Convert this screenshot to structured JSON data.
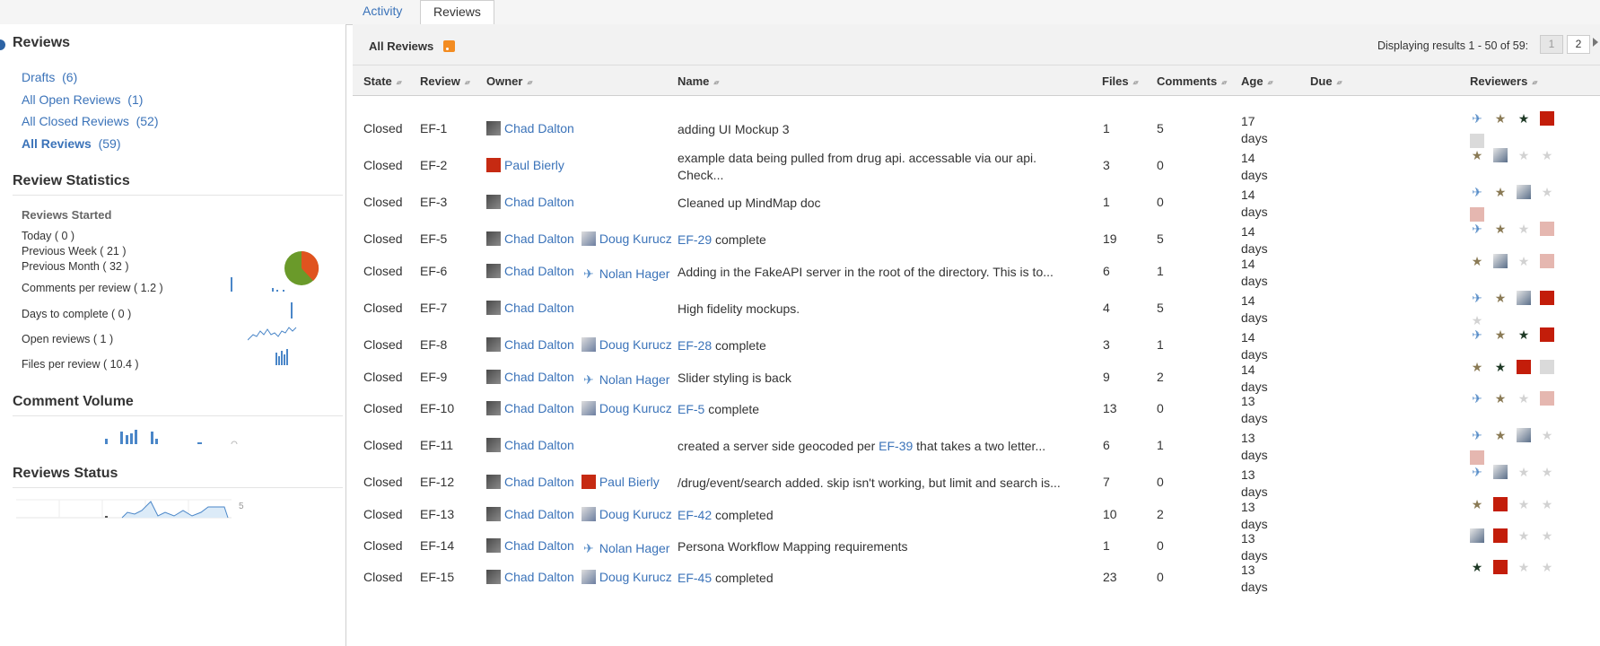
{
  "tabs": [
    {
      "label": "Activity",
      "active": false
    },
    {
      "label": "Reviews",
      "active": true
    }
  ],
  "sidebar": {
    "heading": "Reviews",
    "filters": [
      {
        "label": "Drafts",
        "count": "(6)",
        "selected": false
      },
      {
        "label": "All Open Reviews",
        "count": "(1)",
        "selected": false
      },
      {
        "label": "All Closed Reviews",
        "count": "(52)",
        "selected": false
      },
      {
        "label": "All Reviews",
        "count": "(59)",
        "selected": true
      }
    ],
    "stats_heading": "Review Statistics",
    "started_heading": "Reviews Started",
    "started": [
      "Today ( 0 )",
      "Previous Week ( 21 )",
      "Previous Month ( 32 )"
    ],
    "metrics": [
      "Comments per review ( 1.2 )",
      "Days to complete ( 0 )",
      "Open reviews ( 1 )",
      "Files per review ( 10.4 )"
    ],
    "comment_volume_heading": "Comment Volume",
    "reviews_status_heading": "Reviews Status",
    "reviews_status_label": "5"
  },
  "main": {
    "title": "All Reviews",
    "pager_text": "Displaying results 1 - 50 of 59:",
    "pages": [
      "1",
      "2"
    ],
    "columns": [
      "State",
      "Review",
      "Owner",
      "Name",
      "Files",
      "Comments",
      "Age",
      "Due",
      "Reviewers"
    ],
    "rows": [
      {
        "state": "Closed",
        "id": "EF-1",
        "owners": [
          {
            "name": "Chad Dalton",
            "av": "chad"
          }
        ],
        "name": "adding UI Mockup 3",
        "files": "1",
        "comments": "5",
        "age": [
          "17",
          "days"
        ],
        "reviewers": [
          "blue",
          "tan",
          "dark",
          "red",
          "grey"
        ]
      },
      {
        "state": "Closed",
        "id": "EF-2",
        "owners": [
          {
            "name": "Paul Bierly",
            "av": "paul"
          }
        ],
        "name": "example data being pulled from drug api. accessable via our api. Check...",
        "files": "3",
        "comments": "0",
        "age": [
          "14",
          "days"
        ],
        "reviewers": [
          "tan",
          "photo",
          "faint",
          "faint"
        ]
      },
      {
        "state": "Closed",
        "id": "EF-3",
        "owners": [
          {
            "name": "Chad Dalton",
            "av": "chad"
          }
        ],
        "name": "Cleaned up MindMap doc",
        "files": "1",
        "comments": "0",
        "age": [
          "14",
          "days"
        ],
        "reviewers": [
          "blue",
          "tan",
          "photo",
          "faint",
          "pink"
        ]
      },
      {
        "state": "Closed",
        "id": "EF-5",
        "owners": [
          {
            "name": "Chad Dalton",
            "av": "chad"
          },
          {
            "name": "Doug Kurucz",
            "av": "doug"
          }
        ],
        "name_link": "EF-29",
        "name_rest": " complete",
        "files": "19",
        "comments": "5",
        "age": [
          "14",
          "days"
        ],
        "reviewers": [
          "blue",
          "tan",
          "faint",
          "pink"
        ]
      },
      {
        "state": "Closed",
        "id": "EF-6",
        "owners": [
          {
            "name": "Chad Dalton",
            "av": "chad"
          },
          {
            "name": "Nolan Hager",
            "av": "nolan"
          }
        ],
        "name": "Adding in the FakeAPI server in the root of the directory. This is to...",
        "files": "6",
        "comments": "1",
        "age": [
          "14",
          "days"
        ],
        "reviewers": [
          "tan",
          "photo",
          "faint",
          "pink"
        ]
      },
      {
        "state": "Closed",
        "id": "EF-7",
        "owners": [
          {
            "name": "Chad Dalton",
            "av": "chad"
          }
        ],
        "name": "High fidelity mockups.",
        "files": "4",
        "comments": "5",
        "age": [
          "14",
          "days"
        ],
        "reviewers": [
          "blue",
          "tan",
          "photo",
          "red",
          "faint"
        ]
      },
      {
        "state": "Closed",
        "id": "EF-8",
        "owners": [
          {
            "name": "Chad Dalton",
            "av": "chad"
          },
          {
            "name": "Doug Kurucz",
            "av": "doug"
          }
        ],
        "name_link": "EF-28",
        "name_rest": " complete",
        "files": "3",
        "comments": "1",
        "age": [
          "14",
          "days"
        ],
        "reviewers": [
          "blue",
          "tan",
          "dark",
          "red"
        ]
      },
      {
        "state": "Closed",
        "id": "EF-9",
        "owners": [
          {
            "name": "Chad Dalton",
            "av": "chad"
          },
          {
            "name": "Nolan Hager",
            "av": "nolan"
          }
        ],
        "name": "Slider styling is back",
        "files": "9",
        "comments": "2",
        "age": [
          "14",
          "days"
        ],
        "reviewers": [
          "tan",
          "dark",
          "red",
          "grey"
        ]
      },
      {
        "state": "Closed",
        "id": "EF-10",
        "owners": [
          {
            "name": "Chad Dalton",
            "av": "chad"
          },
          {
            "name": "Doug Kurucz",
            "av": "doug"
          }
        ],
        "name_link": "EF-5",
        "name_rest": " complete",
        "files": "13",
        "comments": "0",
        "age": [
          "13",
          "days"
        ],
        "reviewers": [
          "blue",
          "tan",
          "faint",
          "pink"
        ]
      },
      {
        "state": "Closed",
        "id": "EF-11",
        "owners": [
          {
            "name": "Chad Dalton",
            "av": "chad"
          }
        ],
        "name_pre": "created a server side geocoded per ",
        "name_link": "EF-39",
        "name_rest": " that takes a two letter...",
        "files": "6",
        "comments": "1",
        "age": [
          "13",
          "days"
        ],
        "reviewers": [
          "blue",
          "tan",
          "photo",
          "faint",
          "pink"
        ]
      },
      {
        "state": "Closed",
        "id": "EF-12",
        "owners": [
          {
            "name": "Chad Dalton",
            "av": "chad"
          },
          {
            "name": "Paul Bierly",
            "av": "paul"
          }
        ],
        "name": "/drug/event/search added. skip isn't working, but limit and search is...",
        "files": "7",
        "comments": "0",
        "age": [
          "13",
          "days"
        ],
        "reviewers": [
          "blue",
          "photo",
          "faint",
          "faint"
        ]
      },
      {
        "state": "Closed",
        "id": "EF-13",
        "owners": [
          {
            "name": "Chad Dalton",
            "av": "chad"
          },
          {
            "name": "Doug Kurucz",
            "av": "doug"
          }
        ],
        "name_link": "EF-42",
        "name_rest": " completed",
        "files": "10",
        "comments": "2",
        "age": [
          "13",
          "days"
        ],
        "reviewers": [
          "tan",
          "red",
          "faint",
          "faint"
        ]
      },
      {
        "state": "Closed",
        "id": "EF-14",
        "owners": [
          {
            "name": "Chad Dalton",
            "av": "chad"
          },
          {
            "name": "Nolan Hager",
            "av": "nolan"
          }
        ],
        "name": "Persona Workflow Mapping requirements",
        "files": "1",
        "comments": "0",
        "age": [
          "13",
          "days"
        ],
        "reviewers": [
          "photo",
          "red",
          "faint",
          "faint"
        ]
      },
      {
        "state": "Closed",
        "id": "EF-15",
        "owners": [
          {
            "name": "Chad Dalton",
            "av": "chad"
          },
          {
            "name": "Doug Kurucz",
            "av": "doug"
          }
        ],
        "name_link": "EF-45",
        "name_rest": " completed",
        "files": "23",
        "comments": "0",
        "age": [
          "13",
          "days"
        ],
        "reviewers": [
          "dark",
          "red",
          "faint",
          "faint"
        ]
      }
    ]
  },
  "colors": {
    "link": "#3b73b9",
    "pie_green": "#6a9a2a",
    "pie_orange": "#e0531f",
    "rss": "#f38c22"
  }
}
